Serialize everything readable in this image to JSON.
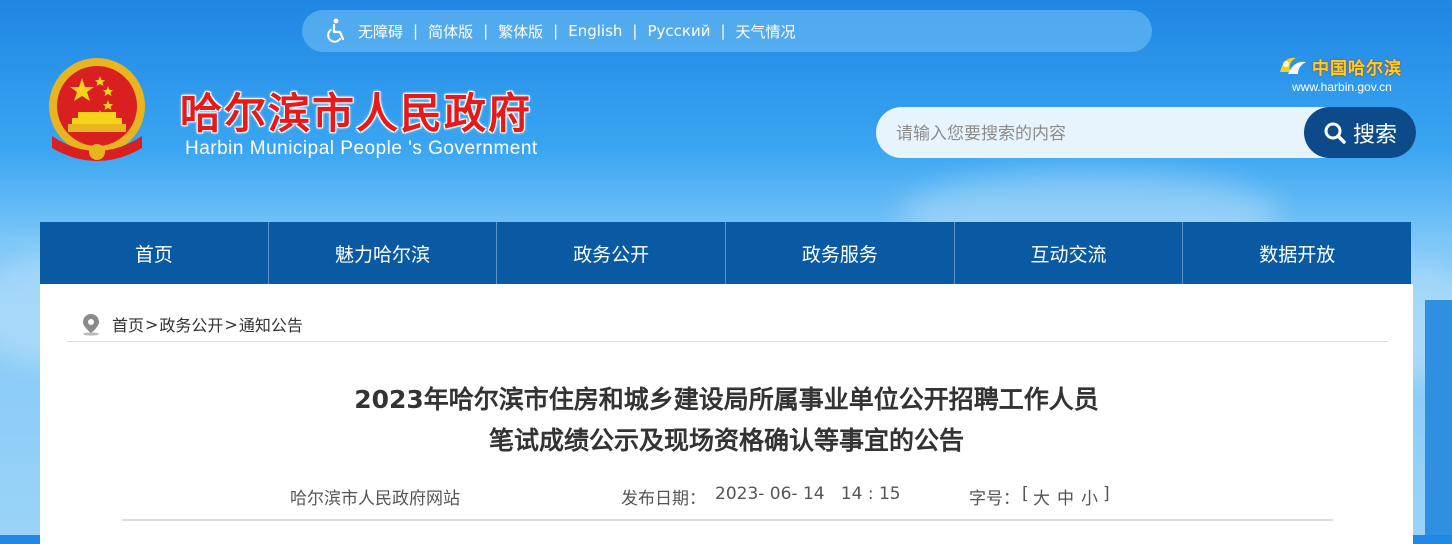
{
  "topbar": {
    "accessibility_label": "无障碍",
    "items": [
      "简体版",
      "繁体版",
      "English",
      "Русский",
      "天气情况"
    ],
    "separator": "|"
  },
  "header": {
    "title_cn": "哈尔滨市人民政府",
    "title_en": "Harbin Municipal People 's Government",
    "logo_cn": "中国哈尔滨",
    "logo_url": "www.harbin.gov.cn"
  },
  "search": {
    "placeholder": "请输入您要搜索的内容",
    "button_label": "搜索"
  },
  "nav": {
    "items": [
      "首页",
      "魅力哈尔滨",
      "政务公开",
      "政务服务",
      "互动交流",
      "数据开放"
    ]
  },
  "breadcrumb": {
    "items": [
      "首页",
      "政务公开",
      "通知公告"
    ],
    "separator": ">"
  },
  "article": {
    "title_line1": "2023年哈尔滨市住房和城乡建设局所属事业单位公开招聘工作人员",
    "title_line2": "笔试成绩公示及现场资格确认等事宜的公告",
    "source": "哈尔滨市人民政府网站",
    "date_label": "发布日期：",
    "date_value": "2023- 06- 14   14 : 15",
    "font_label": "字号：",
    "font_open": "[",
    "font_large": "大",
    "font_medium": "中",
    "font_small": "小",
    "font_close": "]"
  },
  "colors": {
    "nav_bg": "#0a5aa3",
    "search_btn": "#0d4a8a",
    "title_red": "#e51b1b",
    "logo_gold": "#f7d21a"
  },
  "icons": [
    "accessibility-icon",
    "national-emblem-icon",
    "harbin-logo-icon",
    "search-icon",
    "location-pin-icon"
  ]
}
